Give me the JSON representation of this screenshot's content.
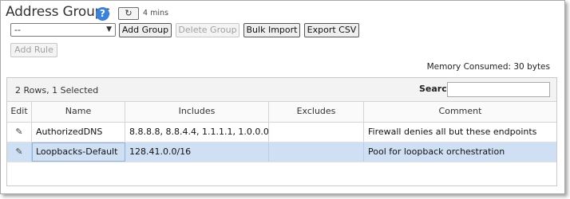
{
  "header": {
    "title": "Address Groups",
    "help_icon": "?",
    "refresh_icon": "↻",
    "age": "4 mins"
  },
  "toolbar": {
    "group_select_value": "--",
    "add_group": "Add Group",
    "delete_group": "Delete Group",
    "bulk_import": "Bulk Import",
    "export_csv": "Export CSV",
    "add_rule": "Add Rule"
  },
  "memory_consumed": "Memory Consumed: 30 bytes",
  "table": {
    "rows_info": "2 Rows, 1 Selected",
    "search_label": "Search",
    "search_value": "",
    "columns": [
      "Edit",
      "Name",
      "Includes",
      "Excludes",
      "Comment"
    ],
    "rows": [
      {
        "edit_icon": "✎",
        "name": "AuthorizedDNS",
        "includes": "8.8.8.8, 8.8.4.4, 1.1.1.1, 1.0.0.0",
        "excludes": "",
        "comment": "Firewall denies all but these endpoints",
        "selected": false
      },
      {
        "edit_icon": "✎",
        "name": "Loopbacks-Default",
        "includes": "128.41.0.0/16",
        "excludes": "",
        "comment": "Pool for loopback orchestration",
        "selected": true
      }
    ]
  },
  "colors": {
    "selected_row": "#cfe0f5",
    "help_icon": "#3b82d8"
  }
}
